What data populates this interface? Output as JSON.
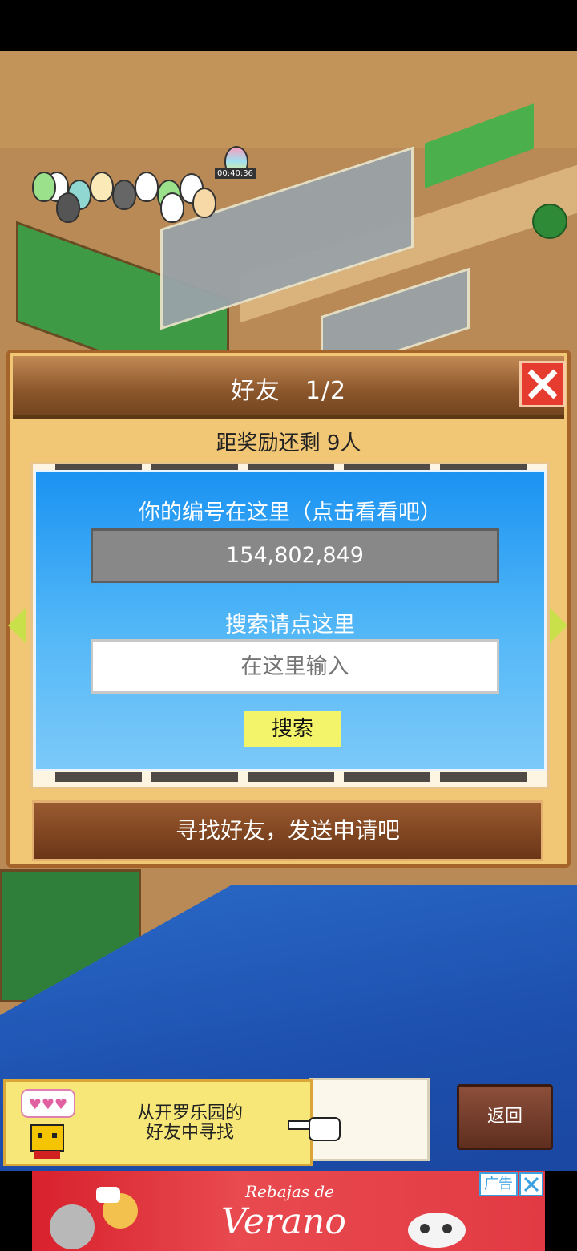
{
  "dialog": {
    "title": "好友　1/2",
    "reward_text": "距奖励还剩 9人",
    "id_hint": "你的编号在这里（点击看看吧）",
    "player_id": "154,802,849",
    "search_hint": "搜索请点这里",
    "search_placeholder": "在这里输入",
    "search_button": "搜索",
    "find_button": "寻找好友，发送申请吧"
  },
  "map": {
    "timer": "00:40:36"
  },
  "bottom": {
    "kairo_text_line1": "从开罗乐园的",
    "kairo_text_line2": "好友中寻找",
    "back_button": "返回"
  },
  "ad": {
    "line1": "Rebajas de",
    "line2": "Verano",
    "badge": "广告"
  },
  "colors": {
    "dialog_bg": "#f1c776",
    "panel_blue": "#1b93f2",
    "close_red": "#e63c2f",
    "search_yellow": "#f3f46a",
    "ad_red": "#d8212d"
  }
}
